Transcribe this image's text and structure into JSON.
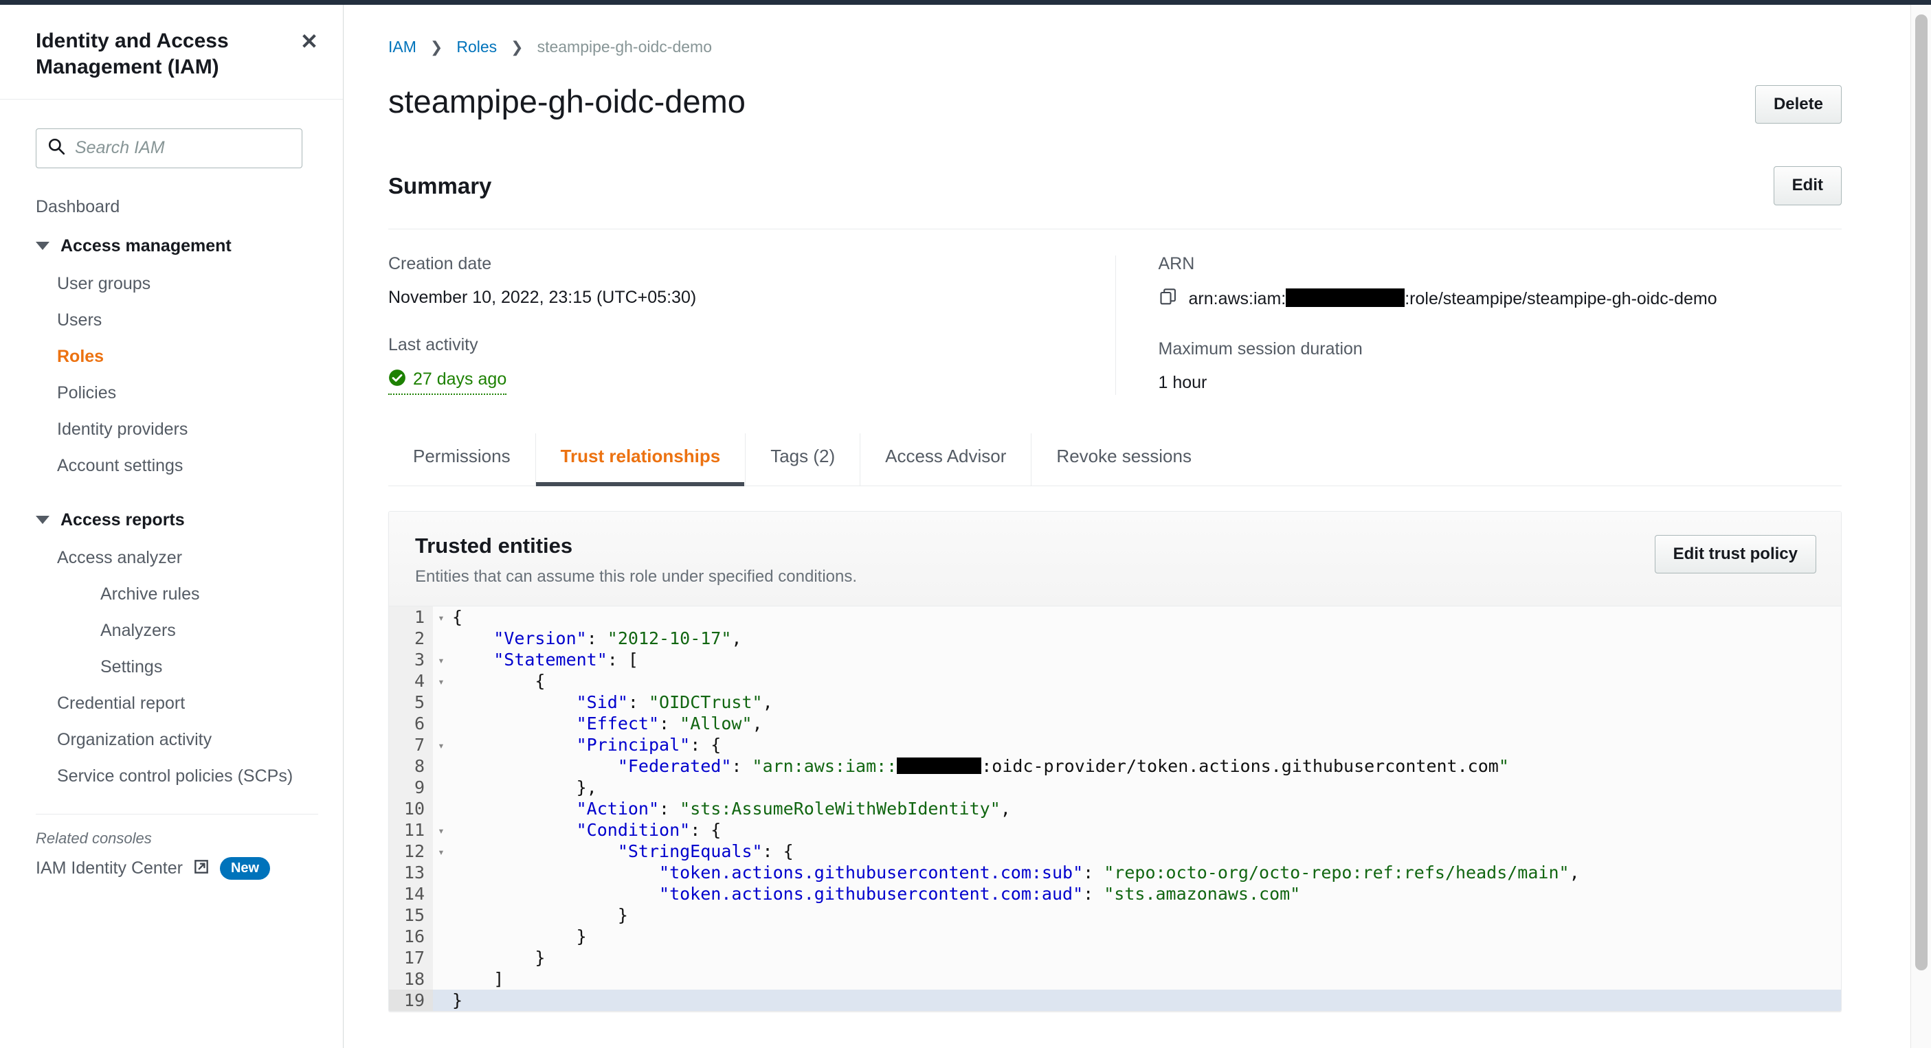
{
  "sidebar": {
    "title": "Identity and Access Management (IAM)",
    "close_label": "✕",
    "search": {
      "placeholder": "Search IAM",
      "value": ""
    },
    "dashboard_label": "Dashboard",
    "groups": [
      {
        "label": "Access management",
        "items": [
          {
            "label": "User groups",
            "active": false
          },
          {
            "label": "Users",
            "active": false
          },
          {
            "label": "Roles",
            "active": true
          },
          {
            "label": "Policies",
            "active": false
          },
          {
            "label": "Identity providers",
            "active": false
          },
          {
            "label": "Account settings",
            "active": false
          }
        ]
      },
      {
        "label": "Access reports",
        "items": [
          {
            "label": "Access analyzer",
            "active": false
          },
          {
            "label": "Archive rules",
            "active": false,
            "indent": 2
          },
          {
            "label": "Analyzers",
            "active": false,
            "indent": 2
          },
          {
            "label": "Settings",
            "active": false,
            "indent": 2
          },
          {
            "label": "Credential report",
            "active": false
          },
          {
            "label": "Organization activity",
            "active": false
          },
          {
            "label": "Service control policies (SCPs)",
            "active": false
          }
        ]
      }
    ],
    "related_consoles_label": "Related consoles",
    "related_link_label": "IAM Identity Center",
    "related_badge": "New"
  },
  "breadcrumb": {
    "item1": "IAM",
    "item2": "Roles",
    "current": "steampipe-gh-oidc-demo",
    "separator": "❯"
  },
  "header": {
    "page_title": "steampipe-gh-oidc-demo",
    "delete_label": "Delete"
  },
  "summary": {
    "heading": "Summary",
    "edit_label": "Edit",
    "creation_date_label": "Creation date",
    "creation_date_value": "November 10, 2022, 23:15 (UTC+05:30)",
    "last_activity_label": "Last activity",
    "last_activity_value": "27 days ago",
    "arn_label": "ARN",
    "arn_prefix": "arn:aws:iam:",
    "arn_suffix": ":role/steampipe/steampipe-gh-oidc-demo",
    "max_session_label": "Maximum session duration",
    "max_session_value": "1 hour"
  },
  "tabs": [
    {
      "label": "Permissions",
      "active": false
    },
    {
      "label": "Trust relationships",
      "active": true
    },
    {
      "label": "Tags (2)",
      "active": false
    },
    {
      "label": "Access Advisor",
      "active": false
    },
    {
      "label": "Revoke sessions",
      "active": false
    }
  ],
  "trusted_entities": {
    "title": "Trusted entities",
    "subtitle": "Entities that can assume this role under specified conditions.",
    "edit_trust_policy_label": "Edit trust policy",
    "policy_lines": [
      {
        "n": 1,
        "fold": true,
        "text": "{"
      },
      {
        "n": 2,
        "fold": false,
        "text": "    \"Version\": \"2012-10-17\","
      },
      {
        "n": 3,
        "fold": true,
        "text": "    \"Statement\": ["
      },
      {
        "n": 4,
        "fold": true,
        "text": "        {"
      },
      {
        "n": 5,
        "fold": false,
        "text": "            \"Sid\": \"OIDCTrust\","
      },
      {
        "n": 6,
        "fold": false,
        "text": "            \"Effect\": \"Allow\","
      },
      {
        "n": 7,
        "fold": true,
        "text": "            \"Principal\": {"
      },
      {
        "n": 8,
        "fold": false,
        "text": "                \"Federated\": \"arn:aws:iam::[REDACTED]:oidc-provider/token.actions.githubusercontent.com\""
      },
      {
        "n": 9,
        "fold": false,
        "text": "            },"
      },
      {
        "n": 10,
        "fold": false,
        "text": "            \"Action\": \"sts:AssumeRoleWithWebIdentity\","
      },
      {
        "n": 11,
        "fold": true,
        "text": "            \"Condition\": {"
      },
      {
        "n": 12,
        "fold": true,
        "text": "                \"StringEquals\": {"
      },
      {
        "n": 13,
        "fold": false,
        "text": "                    \"token.actions.githubusercontent.com:sub\": \"repo:octo-org/octo-repo:ref:refs/heads/main\","
      },
      {
        "n": 14,
        "fold": false,
        "text": "                    \"token.actions.githubusercontent.com:aud\": \"sts.amazonaws.com\""
      },
      {
        "n": 15,
        "fold": false,
        "text": "                }"
      },
      {
        "n": 16,
        "fold": false,
        "text": "            }"
      },
      {
        "n": 17,
        "fold": false,
        "text": "        }"
      },
      {
        "n": 18,
        "fold": false,
        "text": "    ]"
      },
      {
        "n": 19,
        "fold": false,
        "text": "}",
        "active": true
      }
    ]
  },
  "colors": {
    "accent_orange": "#ec7211",
    "link_blue": "#0073bb",
    "success_green": "#1d8102",
    "badge_blue": "#0073bb",
    "topbar": "#232f3e"
  }
}
